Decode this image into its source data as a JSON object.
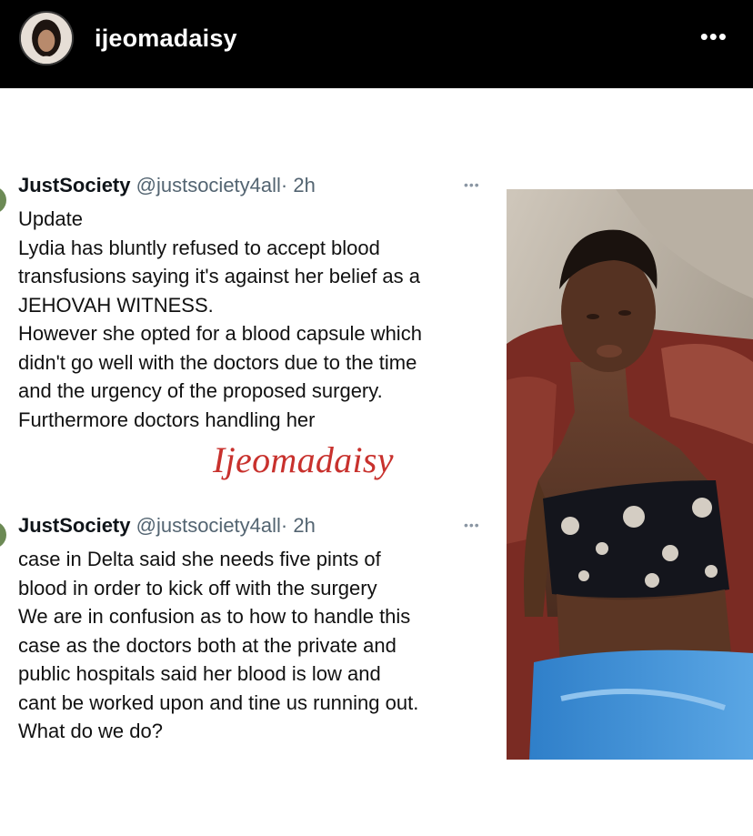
{
  "header": {
    "username": "ijeomadaisy",
    "avatar_icon": "profile-avatar",
    "more_icon": "more-horizontal-icon",
    "more_label": "•••"
  },
  "tweets": [
    {
      "name": "JustSociety",
      "handle": "@justsociety4all",
      "time": "· 2h",
      "more_label": "•••",
      "lines": [
        "Update",
        "Lydia has bluntly refused to accept blood",
        "transfusions saying it's against her belief as a",
        "JEHOVAH WITNESS.",
        "However she opted for a blood capsule which",
        "didn't go well with the doctors due to the time",
        "and the urgency of the proposed surgery.",
        "Furthermore doctors handling her"
      ]
    },
    {
      "name": "JustSociety",
      "handle": "@justsociety4all",
      "time": "· 2h",
      "more_label": "•••",
      "lines": [
        "case in Delta said she needs five pints of",
        "blood in order to kick off with the surgery",
        "We are in confusion as to how to handle this",
        "case as the doctors both at the private and",
        "public  hospitals said her blood is low and",
        "cant be worked upon and tine us running out.",
        "What do we do?"
      ]
    }
  ],
  "watermark": "Ijeomadaisy",
  "colors": {
    "header_bg": "#000000",
    "watermark": "#c8312d",
    "handle": "#536471"
  }
}
